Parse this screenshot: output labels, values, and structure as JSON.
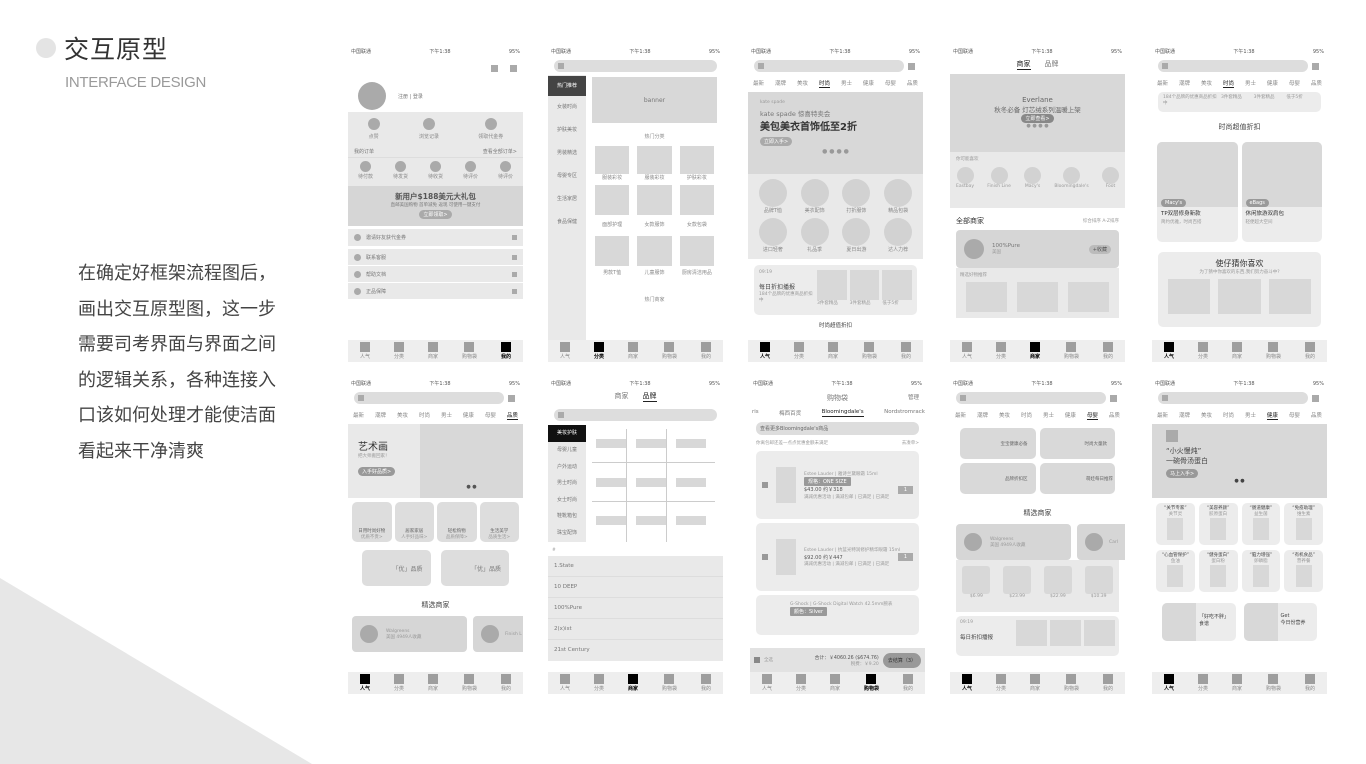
{
  "header": {
    "title": "交互原型",
    "subtitle": "INTERFACE DESIGN"
  },
  "description": [
    "在确定好框架流程图后，",
    "画出交互原型图，这一步",
    "需要司考界面与界面之间",
    "的逻辑关系，各种连接入",
    "口该如何处理才能使洁面",
    "看起来干净清爽"
  ],
  "status_bar": {
    "carrier": "中国联通",
    "time": "下午1:38",
    "battery": "95%"
  },
  "tabbar": [
    "人气",
    "分类",
    "商家",
    "购物袋",
    "我的"
  ],
  "category_tabs": [
    "最新",
    "潮牌",
    "美妆",
    "时尚",
    "男士",
    "健康",
    "母婴",
    "品质"
  ],
  "screens": {
    "me": {
      "login": "注册 | 登录",
      "quick": [
        "点赞",
        "浏览记录",
        "领取代金券"
      ],
      "orders_title": "我的订单",
      "orders_all": "查看全部订单>",
      "order_states": [
        "待付款",
        "待发货",
        "待收货",
        "待评价",
        "待评价"
      ],
      "promo_title": "新用户$188美元大礼包",
      "promo_sub": "直邮美国购物 首单减免 返现 可使用一键支付",
      "promo_btn": "立即领取>",
      "menu": [
        "邀请好友获代金券",
        "联系客服",
        "帮助文档",
        "正品保障"
      ]
    },
    "category": {
      "side": [
        "热门推荐",
        "女装时尚",
        "护肤美妆",
        "男装精选",
        "母婴专区",
        "生活家居",
        "食品保健"
      ],
      "banner": "banner",
      "section1": "热门分类",
      "grid": [
        "服装彩妆",
        "服装彩妆",
        "护肤彩妆",
        "面部护理",
        "女款服饰",
        "女款包袋",
        "男款T恤",
        "儿童服饰",
        "厨房清洁用品"
      ],
      "section2": "热门商家"
    },
    "fashion": {
      "logo": "kate spade",
      "line1": "kate spade 惊喜特卖会",
      "line2": "美包美衣首饰低至2折",
      "btn": "立即入手>",
      "circles": [
        "品牌T恤",
        "美衣配饰",
        "打折服饰",
        "精品包袋",
        "进口轻奢",
        "礼品季",
        "夏日出游",
        "达人力荐"
      ],
      "daily_time": "09:19",
      "daily_title": "每日折扣播报",
      "daily_sub": "184个品牌的优惠商品折扣中",
      "daily_items": [
        "3件套精品",
        "3件套精品",
        "低于5折"
      ],
      "section": "时尚超值折扣"
    },
    "stores": {
      "tabs": [
        "商家",
        "品牌"
      ],
      "banner_brand": "Everlane",
      "banner_line": "秋冬必备 灯芯绒系列温暖上架",
      "banner_btn": "立即查看>",
      "fav_title": "你可能喜欢",
      "fav": [
        "Eastbay",
        "Finish Line",
        "Macy's",
        "Bloomingdale's",
        "Foot"
      ],
      "all_title": "全部商家",
      "sort": [
        "综合排序",
        "A-Z排序"
      ],
      "store_name": "100%Pure",
      "store_loc": "美国",
      "follow": "+收藏",
      "tag_line": "精选好物推荐"
    },
    "fashion2": {
      "daily_sub": "184个品牌的优惠商品折扣中",
      "daily_items": [
        "3件套精品",
        "3件套精品",
        "低于5折"
      ],
      "section": "时尚超值折扣",
      "cards": [
        {
          "tag": "Macy's",
          "title": "TP双层修身新款",
          "sub": "简约优雅，时尚百搭"
        },
        {
          "tag": "eBags",
          "title": "休闲旅游双肩包",
          "sub": "轻便超大空间"
        }
      ],
      "guess_title": "使仔猜你喜欢",
      "guess_sub": "为了猜中你喜欢的东西,我们努力奋斗中?"
    },
    "quality": {
      "banner_title": "艺术画",
      "banner_sub": "把大师搬回家！",
      "banner_btn": "入手好品质>",
      "tiles": [
        {
          "t": "日用时尚好物",
          "s": "优质不贵>"
        },
        {
          "t": "居家家居",
          "s": "人手好品味>"
        },
        {
          "t": "轻松购物",
          "s": "品质保障>"
        },
        {
          "t": "生活美学",
          "s": "品质生活>"
        }
      ],
      "cards": [
        "「优」品质",
        "「优」品质"
      ],
      "section": "精选商家",
      "store": "Walgreens",
      "store_meta": "美国 4949人收藏",
      "store2": "Finish L"
    },
    "brands": {
      "tabs": [
        "商家",
        "品牌"
      ],
      "side": [
        "美妆护肤",
        "母婴儿童",
        "户外运动",
        "男士时尚",
        "女士时尚",
        "鞋靴箱包",
        "珠宝配饰"
      ],
      "index": "#",
      "list": [
        "1.State",
        "10 DEEP",
        "100%Pure",
        "2(x)ist",
        "21st Century"
      ]
    },
    "cart": {
      "title": "购物袋",
      "manage": "管理",
      "store_tabs": [
        "ris",
        "梅西百货",
        "Bloomingdale's",
        "Nordstromrack"
      ],
      "store_search": "查看更多Bloomingdale's商品",
      "notice": "你离包邮还差一点点优惠金额未满足",
      "notice_link": "去凑单>",
      "items": [
        {
          "name": "Estee Lauder | 雅诗兰黛眼霜 15ml",
          "spec": "规格：ONE SIZE",
          "price": "$43.00 约￥318",
          "qty": "1",
          "promo": "满减优惠活动 | 满减包邮 | 已满足 | 已满足"
        },
        {
          "name": "Estee Lauder | 抗蓝光特润修护精华眼霜 15ml",
          "spec": "",
          "price": "$92.00 约￥447",
          "qty": "1",
          "promo": "满减优惠活动 | 满减包邮 | 已满足 | 已满足"
        },
        {
          "name": "G-Shock | G-Shock Digital Watch 42.5mm腕表",
          "spec": "颜色：Silver",
          "price": "",
          "qty": "1",
          "promo": ""
        }
      ],
      "select_all": "全选",
      "total": "合计：￥4060.26 ($674.76)",
      "tax": "税费：￥9.20",
      "checkout": "去结算（3）"
    },
    "mom": {
      "tiles": [
        "宝宝健康必备",
        "时尚大童款",
        "品牌折扣区",
        "萌娃每日推荐"
      ],
      "section": "精选商家",
      "store": "Walgreens",
      "store_meta": "美国 4949人收藏",
      "store2": "Carl",
      "prices": [
        "$6.99",
        "$23.99",
        "$22.99",
        "$10.39"
      ],
      "daily_time": "09:19",
      "daily_title": "每日折扣播报"
    },
    "health": {
      "banner_line1": "“小火慢炖”",
      "banner_line2": "一碗骨汤蛋白",
      "banner_btn": "马上入手>",
      "tiles": [
        {
          "t": "“关节专家”",
          "s": "关节灵"
        },
        {
          "t": "“美容养颜”",
          "s": "胶原蛋白"
        },
        {
          "t": "“肠道健康”",
          "s": "益生菌"
        },
        {
          "t": "“免疫助理”",
          "s": "维生素"
        },
        {
          "t": "“心血管保护”",
          "s": "鱼油"
        },
        {
          "t": "“健身蛋白”",
          "s": "蛋白粉"
        },
        {
          "t": "“脑力增强”",
          "s": "卵磷脂"
        },
        {
          "t": "“有机食品”",
          "s": "营养餐"
        }
      ],
      "cards": [
        {
          "t": "「好吃不胖」",
          "s": "食谱"
        },
        {
          "t": "Get",
          "s": "今日份营养"
        }
      ]
    }
  }
}
